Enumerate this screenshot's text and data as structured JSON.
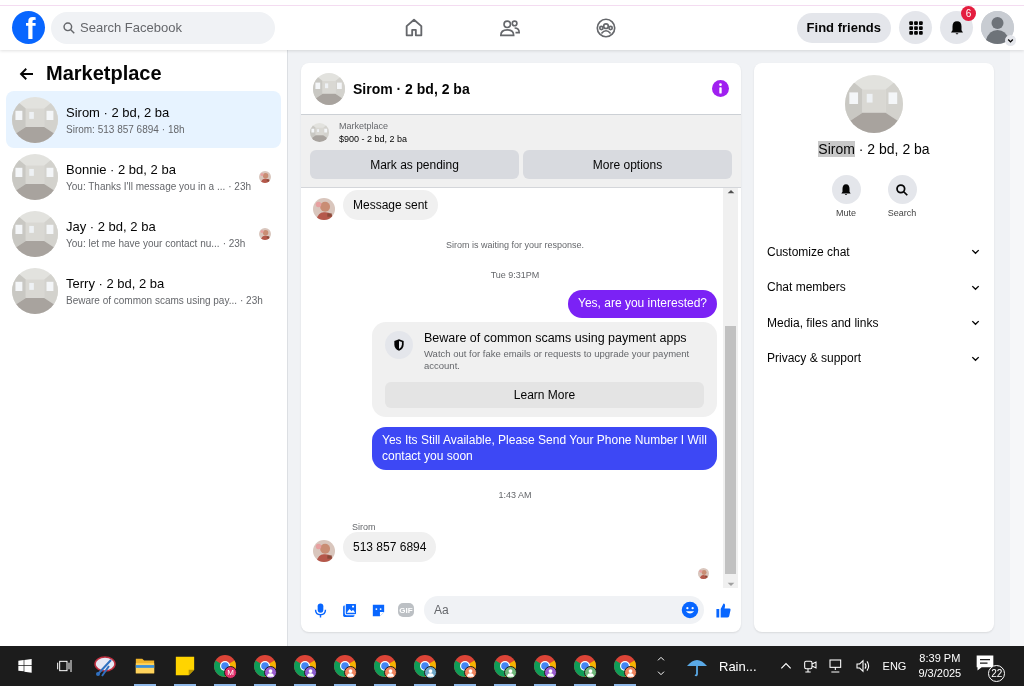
{
  "top_bar": {
    "logo": "f",
    "search": {
      "placeholder": "Search Facebook"
    },
    "nav": [
      {
        "kind": "home",
        "selected": false
      },
      {
        "kind": "friends",
        "selected": false
      },
      {
        "kind": "groups",
        "selected": false
      }
    ],
    "find_friends": "Find friends",
    "notification_count": "6"
  },
  "sidebar": {
    "title": "Marketplace",
    "conversations": [
      {
        "title": "Sirom · 2 bd, 2 ba",
        "preview": "Sirom: 513 857 6894",
        "time": "· 18h",
        "selected": true,
        "seen": false
      },
      {
        "title": "Bonnie · 2 bd, 2 ba",
        "preview": "You: Thanks I'll message you in a ...",
        "time": "· 23h",
        "selected": false,
        "seen": true
      },
      {
        "title": "Jay · 2 bd, 2 ba",
        "preview": "You: let me have your contact nu...",
        "time": "· 23h",
        "selected": false,
        "seen": true
      },
      {
        "title": "Terry · 2 bd, 2 ba",
        "preview": "Beware of common scams using pay...",
        "time": "· 23h",
        "selected": false,
        "seen": false
      }
    ]
  },
  "chat": {
    "title": "Sirom · 2 bd, 2 ba",
    "listing": {
      "label": "Marketplace",
      "detail": "$900 - 2 bd, 2 ba"
    },
    "actions": [
      "Mark as pending",
      "More options"
    ],
    "messages": [
      {
        "kind": "incoming",
        "text": "Message sent"
      },
      {
        "kind": "status",
        "text": "Sirom is waiting for your response."
      },
      {
        "kind": "timestamp",
        "text": "Tue 9:31PM"
      },
      {
        "kind": "outgoing",
        "text": "Yes, are you interested?",
        "color": "#7b22f5"
      },
      {
        "kind": "notice",
        "title": "Beware of common scams using payment apps",
        "text": "Watch out for fake emails or requests to upgrade your payment account.",
        "button": "Learn More"
      },
      {
        "kind": "outgoing",
        "text": "Yes Its Still Available, Please Send Your Phone Number I Will contact you soon",
        "color": "#3d48f5"
      },
      {
        "kind": "timestamp",
        "text": "1:43 AM"
      },
      {
        "kind": "sender",
        "text": "Sirom"
      },
      {
        "kind": "incoming",
        "text": "513 857 6894"
      },
      {
        "kind": "seen"
      }
    ],
    "composer": {
      "gif_label": "GIF",
      "placeholder": "Aa"
    }
  },
  "details": {
    "name": "Sirom",
    "name_highlighted": true,
    "subtitle": " · 2 bd, 2 ba",
    "actions": [
      {
        "kind": "mute",
        "label": "Mute"
      },
      {
        "kind": "search",
        "label": "Search"
      }
    ],
    "sections": [
      {
        "label": "Customize chat",
        "expanded": false
      },
      {
        "label": "Chat members",
        "expanded": false
      },
      {
        "label": "Media, files and links",
        "expanded": false
      },
      {
        "label": "Privacy & support",
        "expanded": false
      }
    ]
  },
  "taskbar": {
    "apps": [
      {
        "kind": "snip"
      },
      {
        "kind": "folder"
      },
      {
        "kind": "notes"
      },
      {
        "kind": "chrome",
        "badge": "M",
        "color": "#e0306b"
      },
      {
        "kind": "chrome",
        "color": "#9a5cd0"
      },
      {
        "kind": "chrome",
        "color": "#8a5cd0"
      },
      {
        "kind": "chrome",
        "color": "#f0845c"
      },
      {
        "kind": "chrome",
        "color": "#f0845c"
      },
      {
        "kind": "chrome",
        "color": "#6fa8c8"
      },
      {
        "kind": "chrome",
        "color": "#f0845c"
      },
      {
        "kind": "chrome",
        "color": "#6fb87a"
      },
      {
        "kind": "chrome",
        "color": "#9a5cd0"
      },
      {
        "kind": "chrome",
        "color": "#6fb87a"
      },
      {
        "kind": "chrome",
        "color": "#f0845c"
      }
    ],
    "weather": "Rain...",
    "language": "ENG",
    "time": "8:39 PM",
    "date": "9/3/2025",
    "notifications": "22"
  }
}
